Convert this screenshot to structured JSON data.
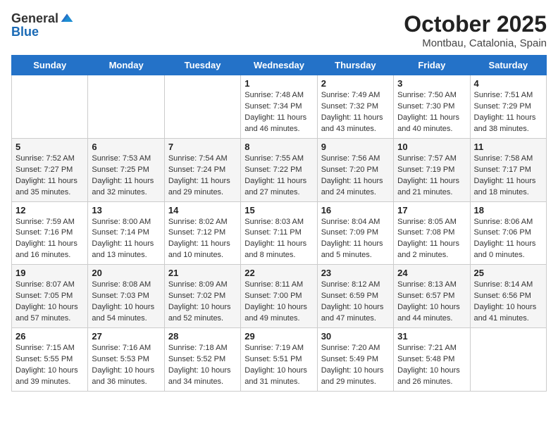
{
  "header": {
    "logo_general": "General",
    "logo_blue": "Blue",
    "month_title": "October 2025",
    "subtitle": "Montbau, Catalonia, Spain"
  },
  "weekdays": [
    "Sunday",
    "Monday",
    "Tuesday",
    "Wednesday",
    "Thursday",
    "Friday",
    "Saturday"
  ],
  "weeks": [
    [
      {
        "day": "",
        "sunrise": "",
        "sunset": "",
        "daylight": ""
      },
      {
        "day": "",
        "sunrise": "",
        "sunset": "",
        "daylight": ""
      },
      {
        "day": "",
        "sunrise": "",
        "sunset": "",
        "daylight": ""
      },
      {
        "day": "1",
        "sunrise": "Sunrise: 7:48 AM",
        "sunset": "Sunset: 7:34 PM",
        "daylight": "Daylight: 11 hours and 46 minutes."
      },
      {
        "day": "2",
        "sunrise": "Sunrise: 7:49 AM",
        "sunset": "Sunset: 7:32 PM",
        "daylight": "Daylight: 11 hours and 43 minutes."
      },
      {
        "day": "3",
        "sunrise": "Sunrise: 7:50 AM",
        "sunset": "Sunset: 7:30 PM",
        "daylight": "Daylight: 11 hours and 40 minutes."
      },
      {
        "day": "4",
        "sunrise": "Sunrise: 7:51 AM",
        "sunset": "Sunset: 7:29 PM",
        "daylight": "Daylight: 11 hours and 38 minutes."
      }
    ],
    [
      {
        "day": "5",
        "sunrise": "Sunrise: 7:52 AM",
        "sunset": "Sunset: 7:27 PM",
        "daylight": "Daylight: 11 hours and 35 minutes."
      },
      {
        "day": "6",
        "sunrise": "Sunrise: 7:53 AM",
        "sunset": "Sunset: 7:25 PM",
        "daylight": "Daylight: 11 hours and 32 minutes."
      },
      {
        "day": "7",
        "sunrise": "Sunrise: 7:54 AM",
        "sunset": "Sunset: 7:24 PM",
        "daylight": "Daylight: 11 hours and 29 minutes."
      },
      {
        "day": "8",
        "sunrise": "Sunrise: 7:55 AM",
        "sunset": "Sunset: 7:22 PM",
        "daylight": "Daylight: 11 hours and 27 minutes."
      },
      {
        "day": "9",
        "sunrise": "Sunrise: 7:56 AM",
        "sunset": "Sunset: 7:20 PM",
        "daylight": "Daylight: 11 hours and 24 minutes."
      },
      {
        "day": "10",
        "sunrise": "Sunrise: 7:57 AM",
        "sunset": "Sunset: 7:19 PM",
        "daylight": "Daylight: 11 hours and 21 minutes."
      },
      {
        "day": "11",
        "sunrise": "Sunrise: 7:58 AM",
        "sunset": "Sunset: 7:17 PM",
        "daylight": "Daylight: 11 hours and 18 minutes."
      }
    ],
    [
      {
        "day": "12",
        "sunrise": "Sunrise: 7:59 AM",
        "sunset": "Sunset: 7:16 PM",
        "daylight": "Daylight: 11 hours and 16 minutes."
      },
      {
        "day": "13",
        "sunrise": "Sunrise: 8:00 AM",
        "sunset": "Sunset: 7:14 PM",
        "daylight": "Daylight: 11 hours and 13 minutes."
      },
      {
        "day": "14",
        "sunrise": "Sunrise: 8:02 AM",
        "sunset": "Sunset: 7:12 PM",
        "daylight": "Daylight: 11 hours and 10 minutes."
      },
      {
        "day": "15",
        "sunrise": "Sunrise: 8:03 AM",
        "sunset": "Sunset: 7:11 PM",
        "daylight": "Daylight: 11 hours and 8 minutes."
      },
      {
        "day": "16",
        "sunrise": "Sunrise: 8:04 AM",
        "sunset": "Sunset: 7:09 PM",
        "daylight": "Daylight: 11 hours and 5 minutes."
      },
      {
        "day": "17",
        "sunrise": "Sunrise: 8:05 AM",
        "sunset": "Sunset: 7:08 PM",
        "daylight": "Daylight: 11 hours and 2 minutes."
      },
      {
        "day": "18",
        "sunrise": "Sunrise: 8:06 AM",
        "sunset": "Sunset: 7:06 PM",
        "daylight": "Daylight: 11 hours and 0 minutes."
      }
    ],
    [
      {
        "day": "19",
        "sunrise": "Sunrise: 8:07 AM",
        "sunset": "Sunset: 7:05 PM",
        "daylight": "Daylight: 10 hours and 57 minutes."
      },
      {
        "day": "20",
        "sunrise": "Sunrise: 8:08 AM",
        "sunset": "Sunset: 7:03 PM",
        "daylight": "Daylight: 10 hours and 54 minutes."
      },
      {
        "day": "21",
        "sunrise": "Sunrise: 8:09 AM",
        "sunset": "Sunset: 7:02 PM",
        "daylight": "Daylight: 10 hours and 52 minutes."
      },
      {
        "day": "22",
        "sunrise": "Sunrise: 8:11 AM",
        "sunset": "Sunset: 7:00 PM",
        "daylight": "Daylight: 10 hours and 49 minutes."
      },
      {
        "day": "23",
        "sunrise": "Sunrise: 8:12 AM",
        "sunset": "Sunset: 6:59 PM",
        "daylight": "Daylight: 10 hours and 47 minutes."
      },
      {
        "day": "24",
        "sunrise": "Sunrise: 8:13 AM",
        "sunset": "Sunset: 6:57 PM",
        "daylight": "Daylight: 10 hours and 44 minutes."
      },
      {
        "day": "25",
        "sunrise": "Sunrise: 8:14 AM",
        "sunset": "Sunset: 6:56 PM",
        "daylight": "Daylight: 10 hours and 41 minutes."
      }
    ],
    [
      {
        "day": "26",
        "sunrise": "Sunrise: 7:15 AM",
        "sunset": "Sunset: 5:55 PM",
        "daylight": "Daylight: 10 hours and 39 minutes."
      },
      {
        "day": "27",
        "sunrise": "Sunrise: 7:16 AM",
        "sunset": "Sunset: 5:53 PM",
        "daylight": "Daylight: 10 hours and 36 minutes."
      },
      {
        "day": "28",
        "sunrise": "Sunrise: 7:18 AM",
        "sunset": "Sunset: 5:52 PM",
        "daylight": "Daylight: 10 hours and 34 minutes."
      },
      {
        "day": "29",
        "sunrise": "Sunrise: 7:19 AM",
        "sunset": "Sunset: 5:51 PM",
        "daylight": "Daylight: 10 hours and 31 minutes."
      },
      {
        "day": "30",
        "sunrise": "Sunrise: 7:20 AM",
        "sunset": "Sunset: 5:49 PM",
        "daylight": "Daylight: 10 hours and 29 minutes."
      },
      {
        "day": "31",
        "sunrise": "Sunrise: 7:21 AM",
        "sunset": "Sunset: 5:48 PM",
        "daylight": "Daylight: 10 hours and 26 minutes."
      },
      {
        "day": "",
        "sunrise": "",
        "sunset": "",
        "daylight": ""
      }
    ]
  ]
}
